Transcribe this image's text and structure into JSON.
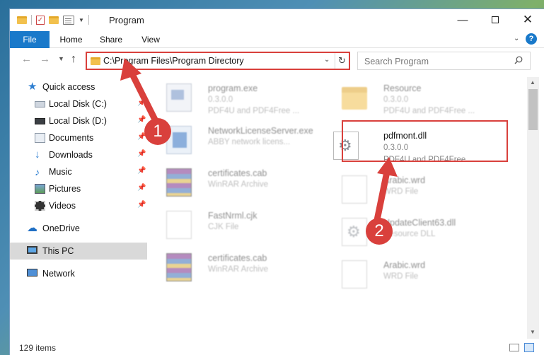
{
  "window": {
    "title": "Program",
    "minimize_glyph": "—",
    "close_glyph": "✕"
  },
  "ribbon": {
    "tabs": [
      {
        "label": "File"
      },
      {
        "label": "Home"
      },
      {
        "label": "Share"
      },
      {
        "label": "View"
      }
    ],
    "help_glyph": "?"
  },
  "address": {
    "path": "C:\\Program Files\\Program Directory",
    "search_placeholder": "Search Program"
  },
  "nav_pane": {
    "items": [
      {
        "label": "Quick access",
        "icon": "star-icon"
      },
      {
        "label": "Local Disk (C:)",
        "icon": "drive-icon"
      },
      {
        "label": "Local Disk (D:)",
        "icon": "drive-icon"
      },
      {
        "label": "Documents",
        "icon": "documents-icon"
      },
      {
        "label": "Downloads",
        "icon": "download-icon"
      },
      {
        "label": "Music",
        "icon": "music-icon"
      },
      {
        "label": "Pictures",
        "icon": "pictures-icon"
      },
      {
        "label": "Videos",
        "icon": "videos-icon"
      },
      {
        "label": "OneDrive",
        "icon": "cloud-icon"
      },
      {
        "label": "This PC",
        "icon": "computer-icon",
        "selected": true
      },
      {
        "label": "Network",
        "icon": "network-icon"
      }
    ]
  },
  "files": [
    {
      "name": "program.exe",
      "line2": "0.3.0.0",
      "line3": "PDF4U and PDF4Free ...",
      "icon": "exe-icon"
    },
    {
      "name": "Resource",
      "line2": "0.3.0.0",
      "line3": "PDF4U and PDF4Free ...",
      "icon": "folder-icon"
    },
    {
      "name": "NetworkLicenseServer.exe",
      "line2": "ABBY network licens...",
      "icon": "exe-icon"
    },
    {
      "name": "pdfmont.dll",
      "line2": "0.3.0.0",
      "line3": "PDF4U and PDF4Free ...",
      "icon": "dll-icon",
      "highlighted": true
    },
    {
      "name": "certificates.cab",
      "line2": "WinRAR Archive",
      "icon": "archive-icon"
    },
    {
      "name": "Arabic.wrd",
      "line2": "WRD File",
      "icon": "file-icon"
    },
    {
      "name": "FastNrml.cjk",
      "line2": "CJK File",
      "icon": "file-icon"
    },
    {
      "name": "UpdateClient63.dll",
      "line2": "Resource DLL",
      "icon": "dll-icon"
    },
    {
      "name": "certificates.cab",
      "line2": "WinRAR Archive",
      "icon": "archive-icon"
    },
    {
      "name": "Arabic.wrd",
      "line2": "WRD File",
      "icon": "file-icon"
    }
  ],
  "status": {
    "item_count": "129 items"
  },
  "annotations": {
    "step1": "1",
    "step2": "2",
    "color": "#d9403c"
  }
}
